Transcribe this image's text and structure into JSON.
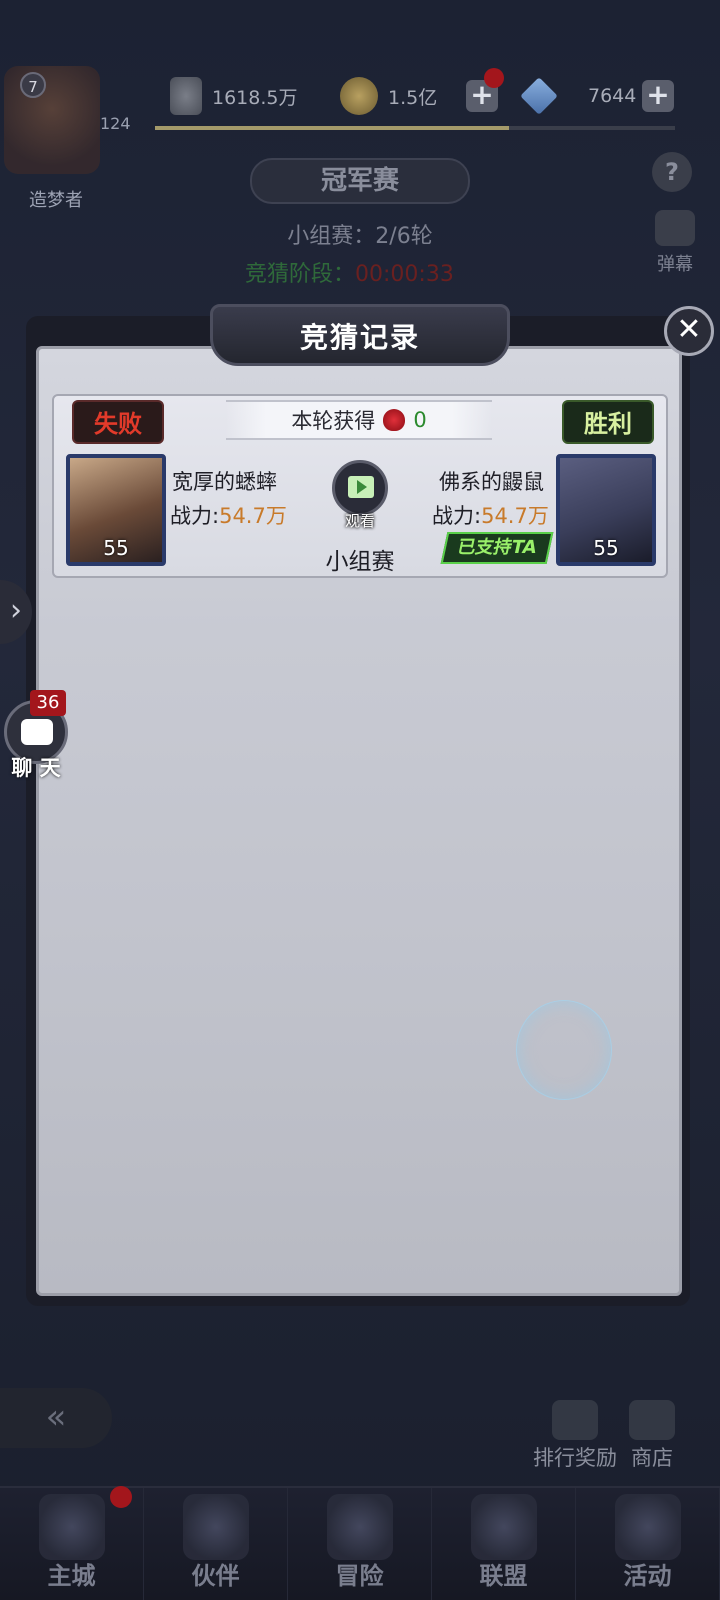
{
  "header": {
    "level": "7",
    "exp": "124",
    "nickname": "造梦者",
    "power": "1618.5万",
    "gold": "1.5亿",
    "gems": "7644",
    "exp_progress": 0.68
  },
  "page": {
    "title": "冠军赛",
    "round": "小组赛：2/6轮",
    "stage_label": "竞猜阶段：",
    "stage_time": "00:00:33",
    "danmu_label": "弹幕",
    "help_symbol": "?"
  },
  "modal": {
    "title": "竞猜记录",
    "close_symbol": "✕",
    "record": {
      "reward_label": "本轮获得",
      "reward_value": "0",
      "lose_tag": "失败",
      "win_tag": "胜利",
      "left_player": {
        "name": "宽厚的蟋蟀",
        "power_label": "战力:",
        "power_value": "54.7万",
        "level": "55"
      },
      "right_player": {
        "name": "佛系的鼹鼠",
        "power_label": "战力:",
        "power_value": "54.7万",
        "level": "55"
      },
      "watch_label": "观看",
      "match_type": "小组赛",
      "support_badge": "已支持TA"
    }
  },
  "side": {
    "chat_label": "聊 天",
    "chat_count": "36"
  },
  "bottom": {
    "rank_reward": "排行奖励",
    "shop": "商店"
  },
  "nav": [
    {
      "label": "主城"
    },
    {
      "label": "伙伴"
    },
    {
      "label": "冒险"
    },
    {
      "label": "联盟"
    },
    {
      "label": "活动"
    }
  ]
}
